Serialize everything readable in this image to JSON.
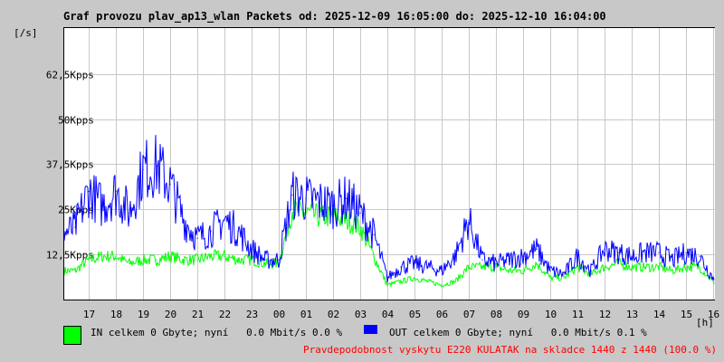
{
  "chart_data": {
    "type": "line",
    "title": "Graf provozu plav_ap13_wlan Packets od: 2025-12-09 16:05:00 do: 2025-12-10 16:04:00",
    "ylabel": "[/s]",
    "xlabel": "[h]",
    "y_ticks": [
      {
        "v": 12.5,
        "label": "12,5K pps"
      },
      {
        "v": 25,
        "label": "25K pps"
      },
      {
        "v": 37.5,
        "label": "37,5K pps"
      },
      {
        "v": 50,
        "label": "50K pps"
      },
      {
        "v": 62.5,
        "label": "62,5K pps"
      }
    ],
    "ylim": [
      0,
      75.5
    ],
    "y_unit": "K pps",
    "x_ticks": [
      "17",
      "18",
      "19",
      "20",
      "21",
      "22",
      "23",
      "00",
      "01",
      "02",
      "03",
      "04",
      "05",
      "06",
      "07",
      "08",
      "09",
      "10",
      "11",
      "12",
      "13",
      "14",
      "15",
      "16"
    ],
    "x_hours_from_1600_step": 0.5,
    "grid": true,
    "series": [
      {
        "name": "IN",
        "color": "#00ff00",
        "values": [
          8,
          8,
          11,
          12,
          12,
          10,
          11,
          11,
          12,
          11,
          11,
          12,
          12,
          11,
          11,
          10,
          10,
          25,
          24,
          23,
          23,
          22,
          20,
          12,
          4,
          5,
          6,
          5,
          4,
          5,
          9,
          9,
          9,
          8,
          8,
          10,
          6,
          6,
          9,
          7,
          9,
          10,
          9,
          9,
          9,
          8,
          9,
          9,
          5
        ]
      },
      {
        "name": "OUT",
        "color": "#0000ff",
        "values": [
          18,
          20,
          30,
          26,
          30,
          24,
          36,
          37,
          32,
          22,
          17,
          19,
          22,
          19,
          14,
          11,
          11,
          29,
          28,
          27,
          26,
          28,
          24,
          18,
          6,
          9,
          10,
          9,
          8,
          12,
          22,
          11,
          10,
          11,
          12,
          14,
          8,
          7,
          12,
          8,
          14,
          13,
          12,
          13,
          13,
          11,
          13,
          12,
          6
        ]
      }
    ]
  },
  "legend": {
    "in_text": "IN celkem 0 Gbyte; nyní   0.0 Mbit/s 0.0 %",
    "out_text": "OUT celkem 0 Gbyte; nyní   0.0 Mbit/s 0.1 %",
    "in_color": "#00ff00",
    "out_color": "#0000ff"
  },
  "footer": "Pravdepodobnost vyskytu E220 KULATAK na skladce 1440 z 1440 (100.0 %)"
}
